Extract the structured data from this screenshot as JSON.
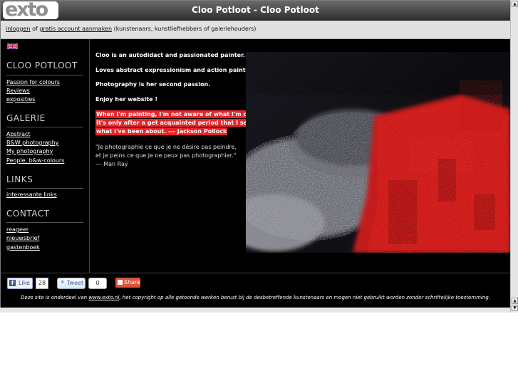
{
  "header": {
    "logo_text": "exto",
    "title": "Cloo Potloot - Cloo Potloot"
  },
  "loginbar": {
    "login_link": "inloggen",
    "connector": "of",
    "create_link": "gratis account aanmaken",
    "suffix": "(kunstenaars, kunstliefhebbers of galeriehouders)"
  },
  "sidebar": {
    "language_flag": "uk-flag-icon",
    "sections": [
      {
        "title": "CLOO POTLOOT",
        "links": [
          "Passion for colours",
          "Reviews",
          "exposities"
        ]
      },
      {
        "title": "GALERIE",
        "links": [
          "Abstract",
          "B&W photography",
          "My photography",
          "People, b&w-colours"
        ]
      },
      {
        "title": "LINKS",
        "links": [
          "interessante links"
        ]
      },
      {
        "title": "CONTACT",
        "links": [
          "reageer",
          "nieuwsbrief",
          "gastenboek"
        ]
      }
    ]
  },
  "content": {
    "intro": [
      "Cloo is an autodidact and passionated painter.",
      "Loves abstract expressionism and action painting.",
      "Photography is her second passion.",
      "Enjoy her website !"
    ],
    "quote_pollock": [
      "When I'm painting, I'm not aware of what I'm doing.",
      "It's only after a get acquainted period that I see",
      "what I've been about. --- Jackson Pollock"
    ],
    "quote_ray": "\"Je photographie ce que je ne désire pas peindre, et je peins ce que je ne peux pas photographier.\" --- Man Ray"
  },
  "footer": {
    "like_label": "Like",
    "like_count": "28",
    "tweet_label": "Tweet",
    "tweet_count": "0",
    "share_label": "Share",
    "copyright_prefix": "Deze site is onderdeel van",
    "copyright_link": "www.exto.nl",
    "copyright_suffix": ", het copyright op alle getoonde werken berust bij de desbetreffende kunstenaars en mogen niet gebruikt worden zonder schriftelijke toestemming."
  },
  "colors": {
    "accent_red": "#e8242a",
    "background": "#000000",
    "header_grey": "#4a4a4a"
  }
}
